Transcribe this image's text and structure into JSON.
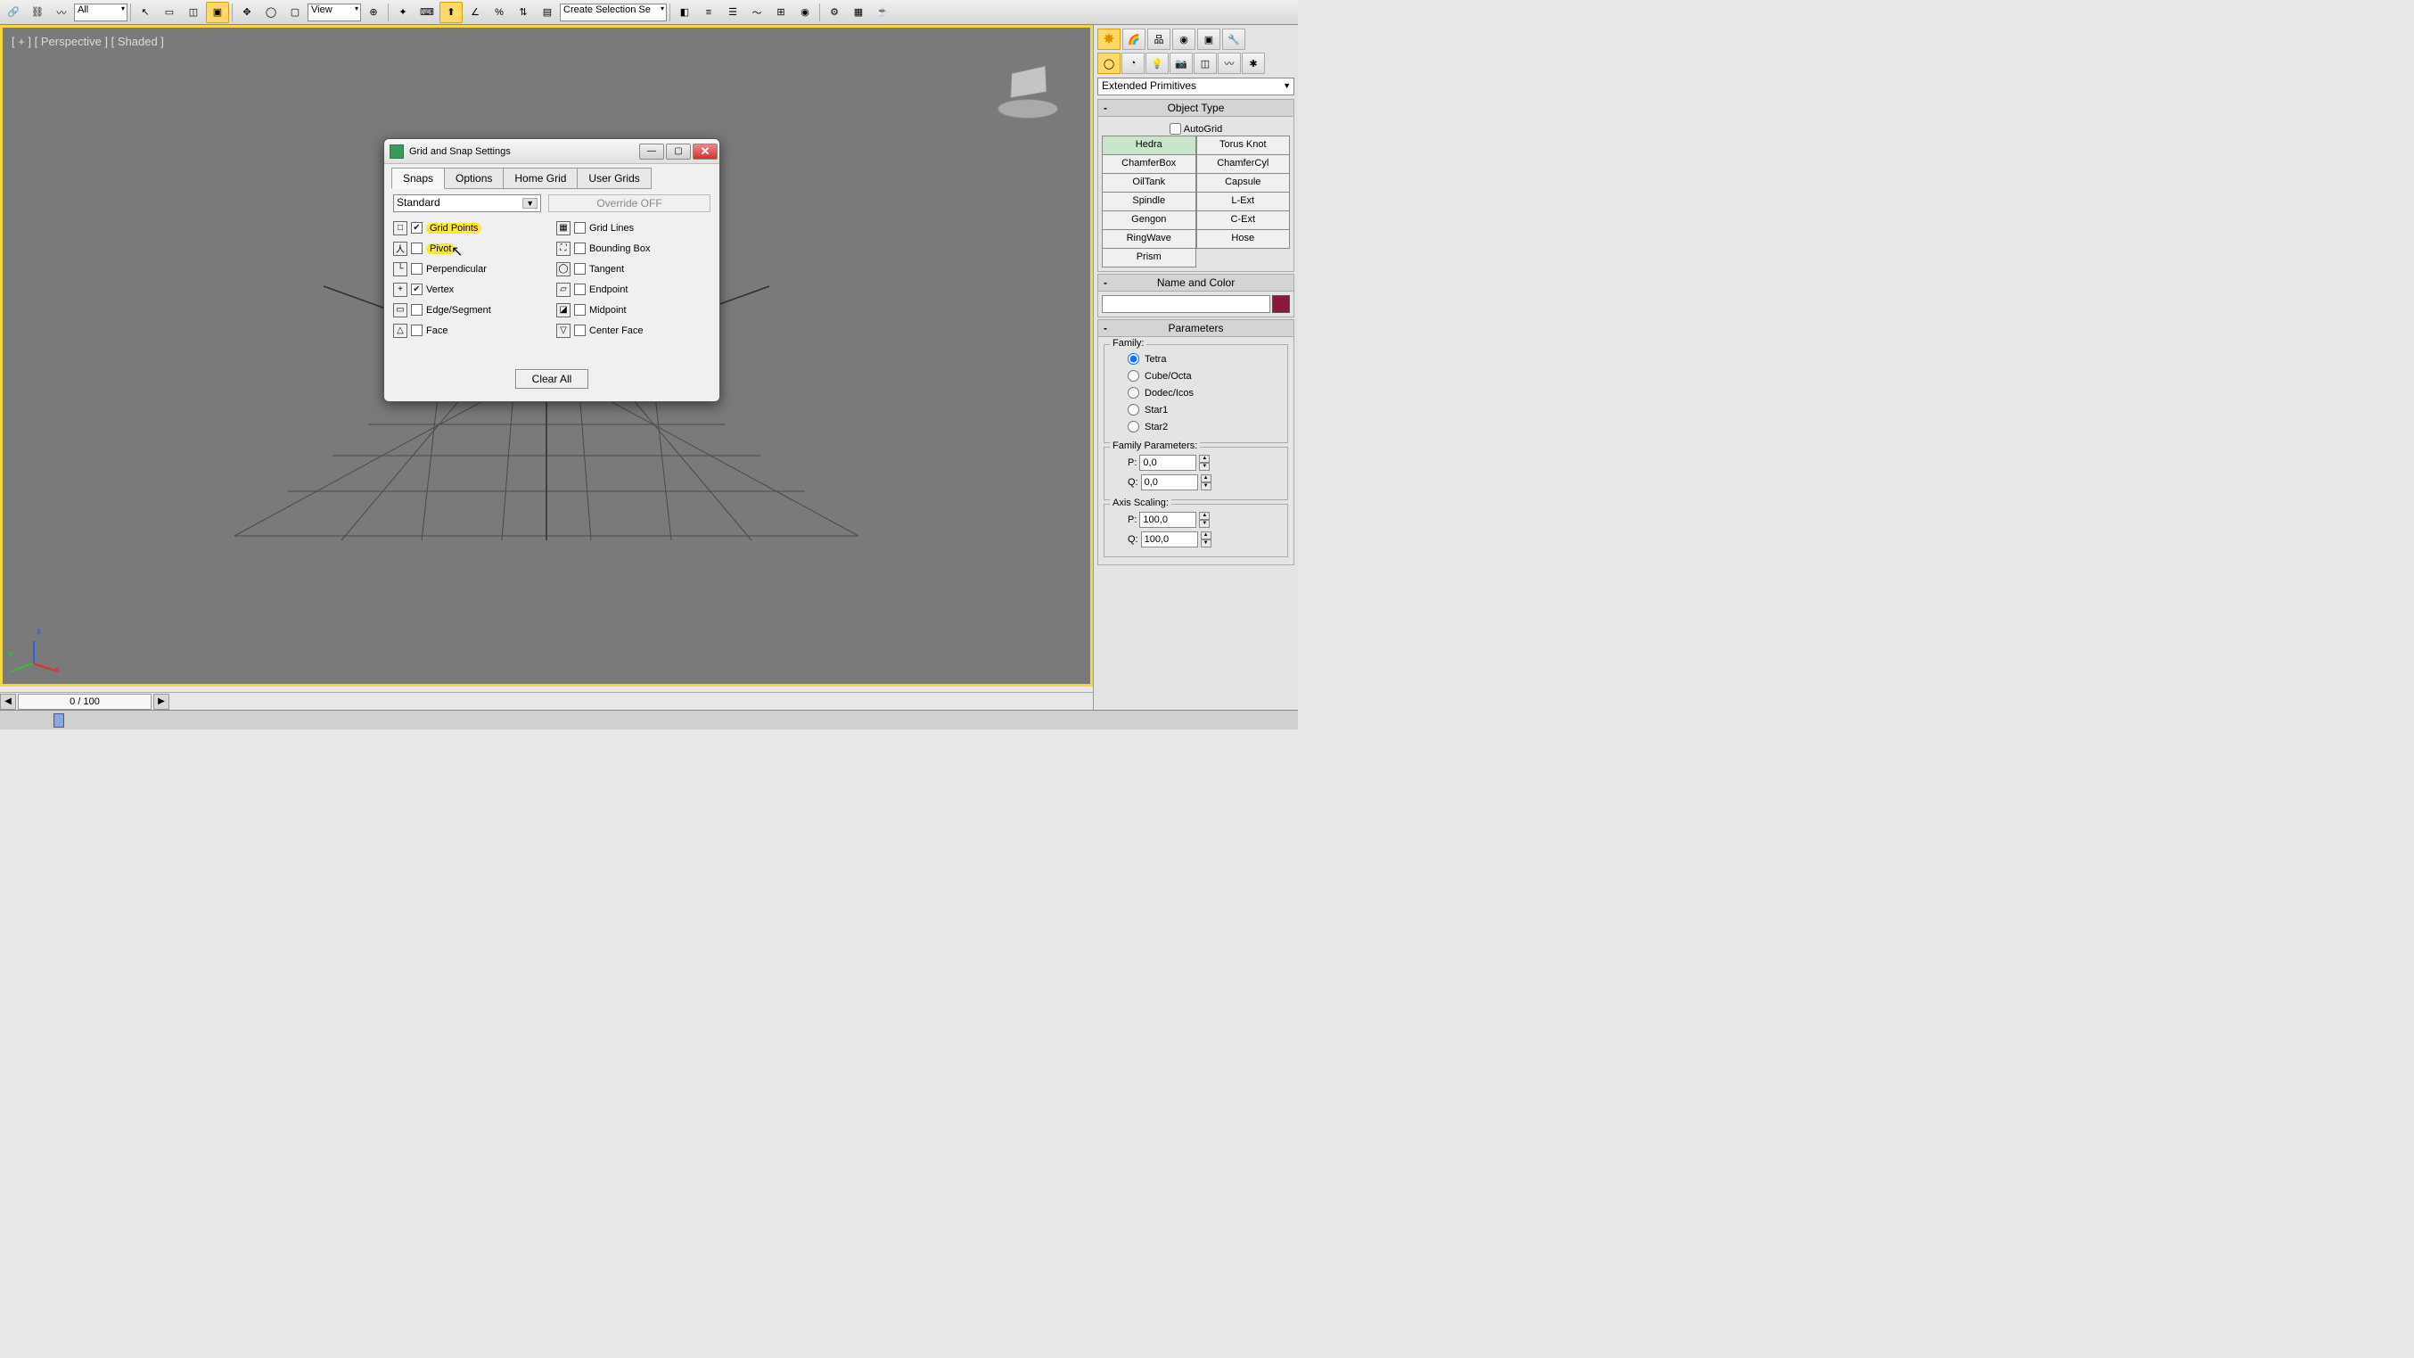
{
  "toolbar": {
    "dropdown_all": "All",
    "dropdown_view": "View",
    "dropdown_create": "Create Selection Se"
  },
  "viewport": {
    "label": "[ + ] [ Perspective ] [ Shaded ]",
    "axis_x": "x",
    "axis_y": "y",
    "axis_z": "z"
  },
  "dialog": {
    "title": "Grid and Snap Settings",
    "tabs": [
      "Snaps",
      "Options",
      "Home Grid",
      "User Grids"
    ],
    "combo": "Standard",
    "override": "Override OFF",
    "snaps_left": [
      {
        "icon": "□",
        "checked": true,
        "label": "Grid Points"
      },
      {
        "icon": "人",
        "checked": false,
        "label": "Pivot"
      },
      {
        "icon": "└",
        "checked": false,
        "label": "Perpendicular"
      },
      {
        "icon": "+",
        "checked": true,
        "label": "Vertex"
      },
      {
        "icon": "▭",
        "checked": false,
        "label": "Edge/Segment"
      },
      {
        "icon": "△",
        "checked": false,
        "label": "Face"
      }
    ],
    "snaps_right": [
      {
        "icon": "▦",
        "checked": false,
        "label": "Grid Lines"
      },
      {
        "icon": "⛶",
        "checked": false,
        "label": "Bounding Box"
      },
      {
        "icon": "◯",
        "checked": false,
        "label": "Tangent"
      },
      {
        "icon": "▱",
        "checked": false,
        "label": "Endpoint"
      },
      {
        "icon": "◪",
        "checked": false,
        "label": "Midpoint"
      },
      {
        "icon": "▽",
        "checked": false,
        "label": "Center Face"
      }
    ],
    "clear_all": "Clear All"
  },
  "panel": {
    "category": "Extended Primitives",
    "rollouts": {
      "object_type": {
        "title": "Object Type",
        "autogrid": "AutoGrid",
        "buttons": [
          "Hedra",
          "Torus Knot",
          "ChamferBox",
          "ChamferCyl",
          "OilTank",
          "Capsule",
          "Spindle",
          "L-Ext",
          "Gengon",
          "C-Ext",
          "RingWave",
          "Hose",
          "Prism"
        ]
      },
      "name_color": {
        "title": "Name and Color"
      },
      "parameters": {
        "title": "Parameters",
        "family": {
          "title": "Family:",
          "options": [
            "Tetra",
            "Cube/Octa",
            "Dodec/Icos",
            "Star1",
            "Star2"
          ]
        },
        "family_params": {
          "title": "Family Parameters:",
          "p_label": "P:",
          "p_val": "0,0",
          "q_label": "Q:",
          "q_val": "0,0"
        },
        "axis_scaling": {
          "title": "Axis Scaling:",
          "p_label": "P:",
          "p_val": "100,0",
          "q_label": "Q:",
          "q_val": "100,0"
        }
      }
    }
  },
  "bottom": {
    "frame": "0 / 100"
  }
}
